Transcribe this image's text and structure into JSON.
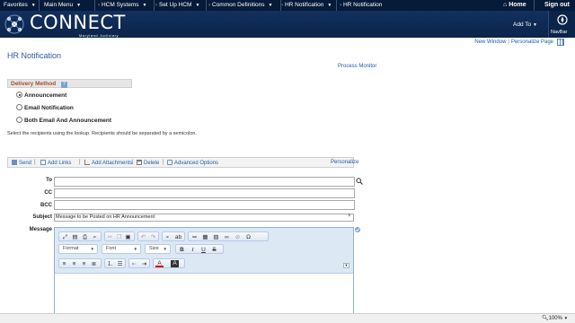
{
  "topnav": {
    "breadcrumbs": [
      "Favorites",
      "Main Menu",
      "HCM Systems",
      "Set Up HCM",
      "Common Definitions",
      "HR Notification",
      "HR Notification"
    ],
    "home": "Home",
    "signout": "Sign out"
  },
  "banner": {
    "logo_word": "CONNECT",
    "logo_sub": "Maryland Judiciary",
    "add_to": "Add To",
    "navbar": "NavBar"
  },
  "page_links": {
    "new_window": "New Window",
    "personalize_page": "Personalize Page"
  },
  "page_title": "HR Notification",
  "process_monitor": "Process Monitor",
  "delivery": {
    "title": "Delivery Method",
    "options": [
      {
        "label": "Announcement",
        "selected": true
      },
      {
        "label": "Email Notification",
        "selected": false
      },
      {
        "label": "Both Email And Announcement",
        "selected": false
      }
    ]
  },
  "hint": "Select the recipients using the lookup. Recipients should be separated by a semicolon.",
  "actions": {
    "send": "Send",
    "add_links": "Add Links",
    "add_attachments": "Add Attachments",
    "delete": "Delete",
    "advanced": "Advanced Options",
    "personalize": "Personalize"
  },
  "fields": {
    "to": "To",
    "cc": "CC",
    "bcc": "BCC",
    "subject": "Subject",
    "subject_value": "Message to be Posted on HR Announcement",
    "message": "Message"
  },
  "editor": {
    "format": "Format",
    "font": "Font",
    "size": "Size"
  },
  "status": {
    "zoom": "100%"
  },
  "colors": {
    "nav_bg": "#061a39",
    "banner_bg": "#12305e",
    "link": "#1e5aa8",
    "title": "#2b5b9c",
    "section": "#a0522d"
  }
}
